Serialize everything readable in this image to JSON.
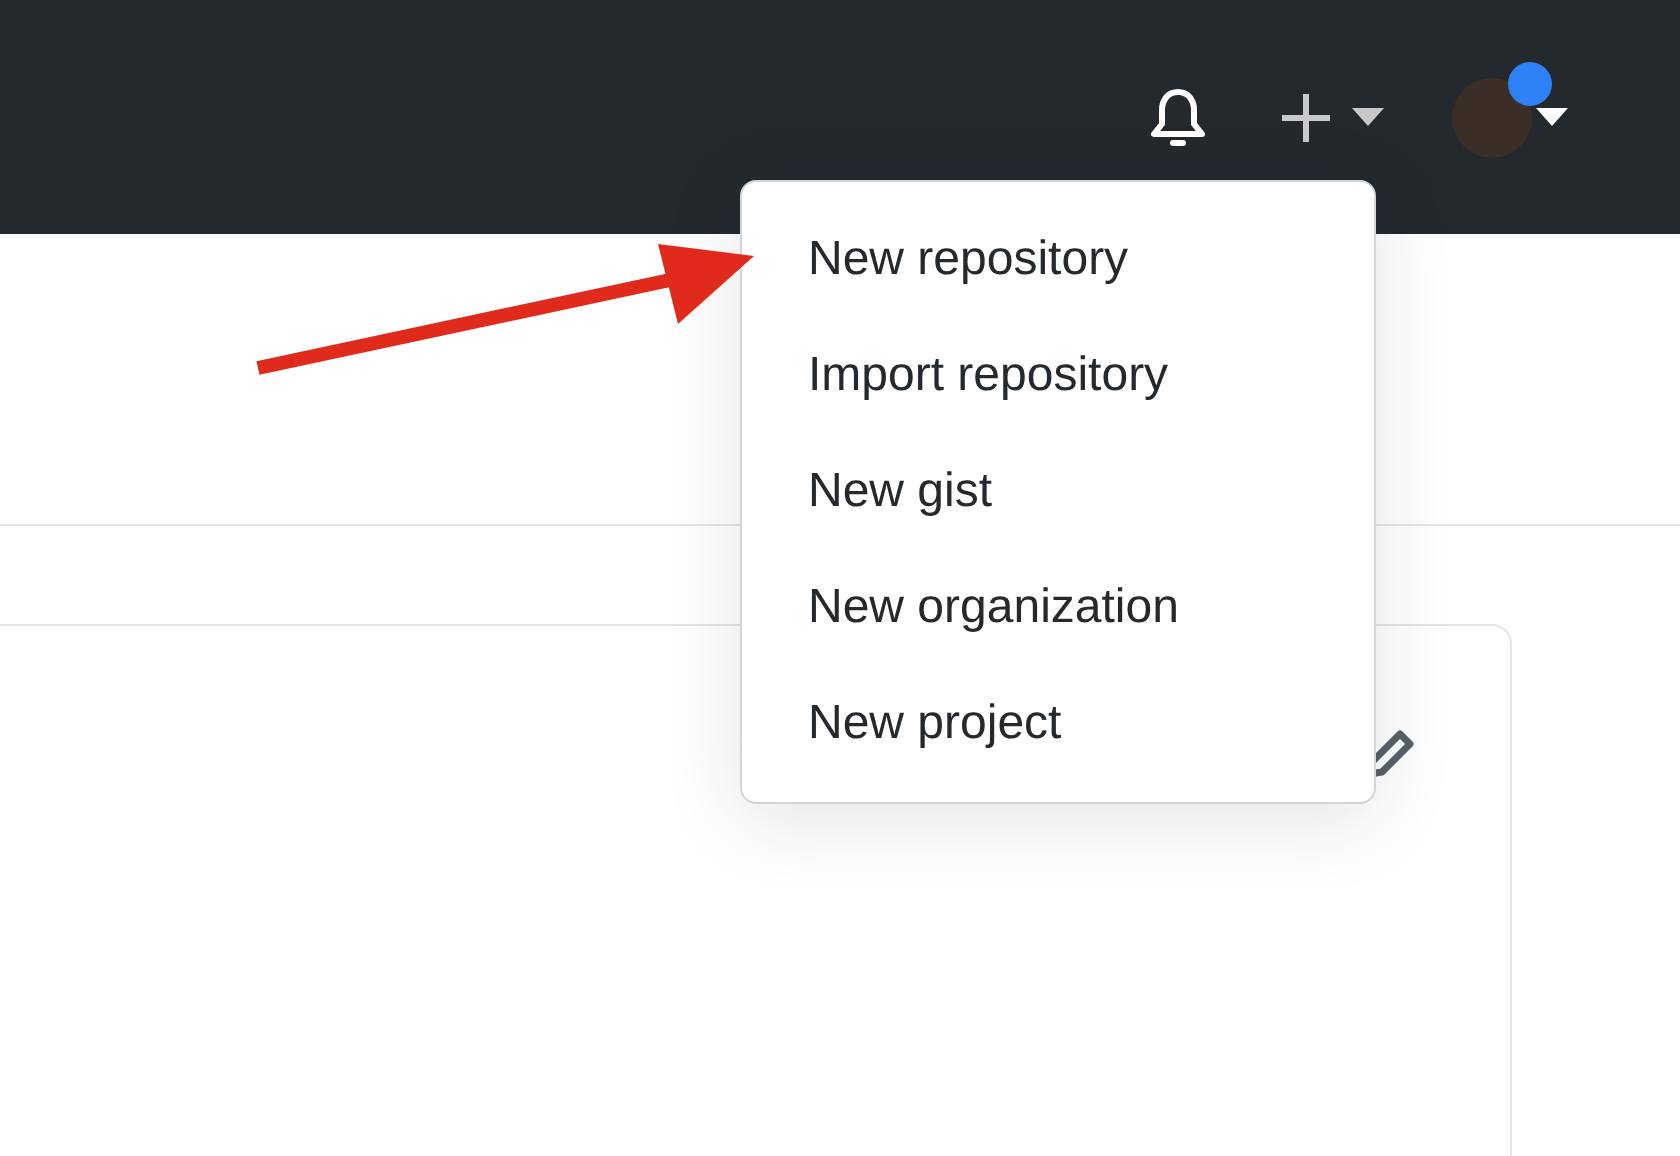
{
  "header": {
    "notification_dot": true
  },
  "create_menu": {
    "expanded": true,
    "items": [
      {
        "label": "New repository"
      },
      {
        "label": "Import repository"
      },
      {
        "label": "New gist"
      },
      {
        "label": "New organization"
      },
      {
        "label": "New project"
      }
    ]
  }
}
